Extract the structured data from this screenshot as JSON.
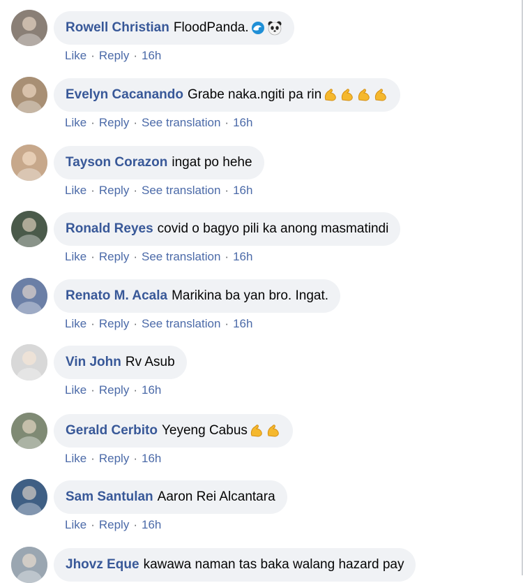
{
  "comments": [
    {
      "author": "Rowell Christian",
      "text": "FloodPanda.",
      "emojis": [
        "wave-emoji",
        "panda-emoji"
      ],
      "like": "Like",
      "reply": "Reply",
      "translation": "",
      "time": "16h",
      "avatar_color": "#8a7f76"
    },
    {
      "author": "Evelyn Cacanando",
      "text": "Grabe naka.ngiti pa rin",
      "emojis": [
        "muscle-emoji",
        "muscle-emoji",
        "muscle-emoji",
        "muscle-emoji"
      ],
      "like": "Like",
      "reply": "Reply",
      "translation": "See translation",
      "time": "16h",
      "avatar_color": "#a88f74"
    },
    {
      "author": "Tayson Corazon",
      "text": "ingat po hehe",
      "emojis": [],
      "like": "Like",
      "reply": "Reply",
      "translation": "See translation",
      "time": "16h",
      "avatar_color": "#c7a88b"
    },
    {
      "author": "Ronald Reyes",
      "text": "covid o bagyo pili ka anong masmatindi",
      "emojis": [],
      "like": "Like",
      "reply": "Reply",
      "translation": "See translation",
      "time": "16h",
      "avatar_color": "#4a5a4a"
    },
    {
      "author": "Renato M. Acala",
      "text": "Marikina ba yan bro. Ingat.",
      "emojis": [],
      "like": "Like",
      "reply": "Reply",
      "translation": "See translation",
      "time": "16h",
      "avatar_color": "#6b7fa6"
    },
    {
      "author": "Vin John",
      "text": "Rv Asub",
      "emojis": [],
      "like": "Like",
      "reply": "Reply",
      "translation": "",
      "time": "16h",
      "avatar_color": "#d8d8d8"
    },
    {
      "author": "Gerald Cerbito",
      "text": "Yeyeng Cabus",
      "emojis": [
        "muscle-emoji",
        "muscle-emoji"
      ],
      "like": "Like",
      "reply": "Reply",
      "translation": "",
      "time": "16h",
      "avatar_color": "#7f8a74"
    },
    {
      "author": "Sam Santulan",
      "text": "Aaron Rei Alcantara",
      "emojis": [],
      "like": "Like",
      "reply": "Reply",
      "translation": "",
      "time": "16h",
      "avatar_color": "#3f5f84"
    },
    {
      "author": "Jhovz Eque",
      "text": "kawawa naman tas baka walang hazard pay",
      "emojis": [],
      "like": "",
      "reply": "",
      "translation": "",
      "time": "",
      "avatar_color": "#9aa6b1"
    }
  ]
}
